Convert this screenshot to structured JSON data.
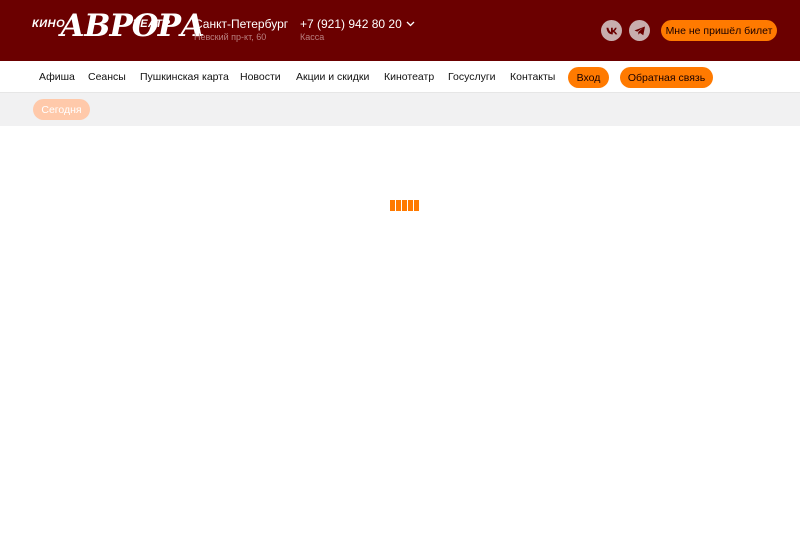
{
  "header": {
    "logo": {
      "small_left": "КИНО",
      "main": "АВРОРА",
      "small_right": "ТЕАТР"
    },
    "city": {
      "name": "Санкт-Петербург",
      "address": "Невский пр-кт, 60"
    },
    "phone": {
      "number": "+7 (921) 942 80 20",
      "label": "Касса"
    },
    "social": [
      {
        "icon": "vk-icon"
      },
      {
        "icon": "telegram-icon"
      }
    ],
    "ticket_button": "Мне не пришёл билет",
    "colors": {
      "background": "#6b0000",
      "accent": "#ff7a00"
    }
  },
  "nav": {
    "items": [
      "Афиша",
      "Сеансы",
      "Пушкинская карта",
      "Новости",
      "Акции и скидки",
      "Кинотеатр",
      "Госуслуги",
      "Контакты"
    ],
    "login_button": "Вход",
    "feedback_button": "Обратная связь"
  },
  "datebar": {
    "today_label": "Сегодня"
  },
  "loader": {
    "icon": "loading-spinner-icon",
    "color": "#ff7a00"
  }
}
